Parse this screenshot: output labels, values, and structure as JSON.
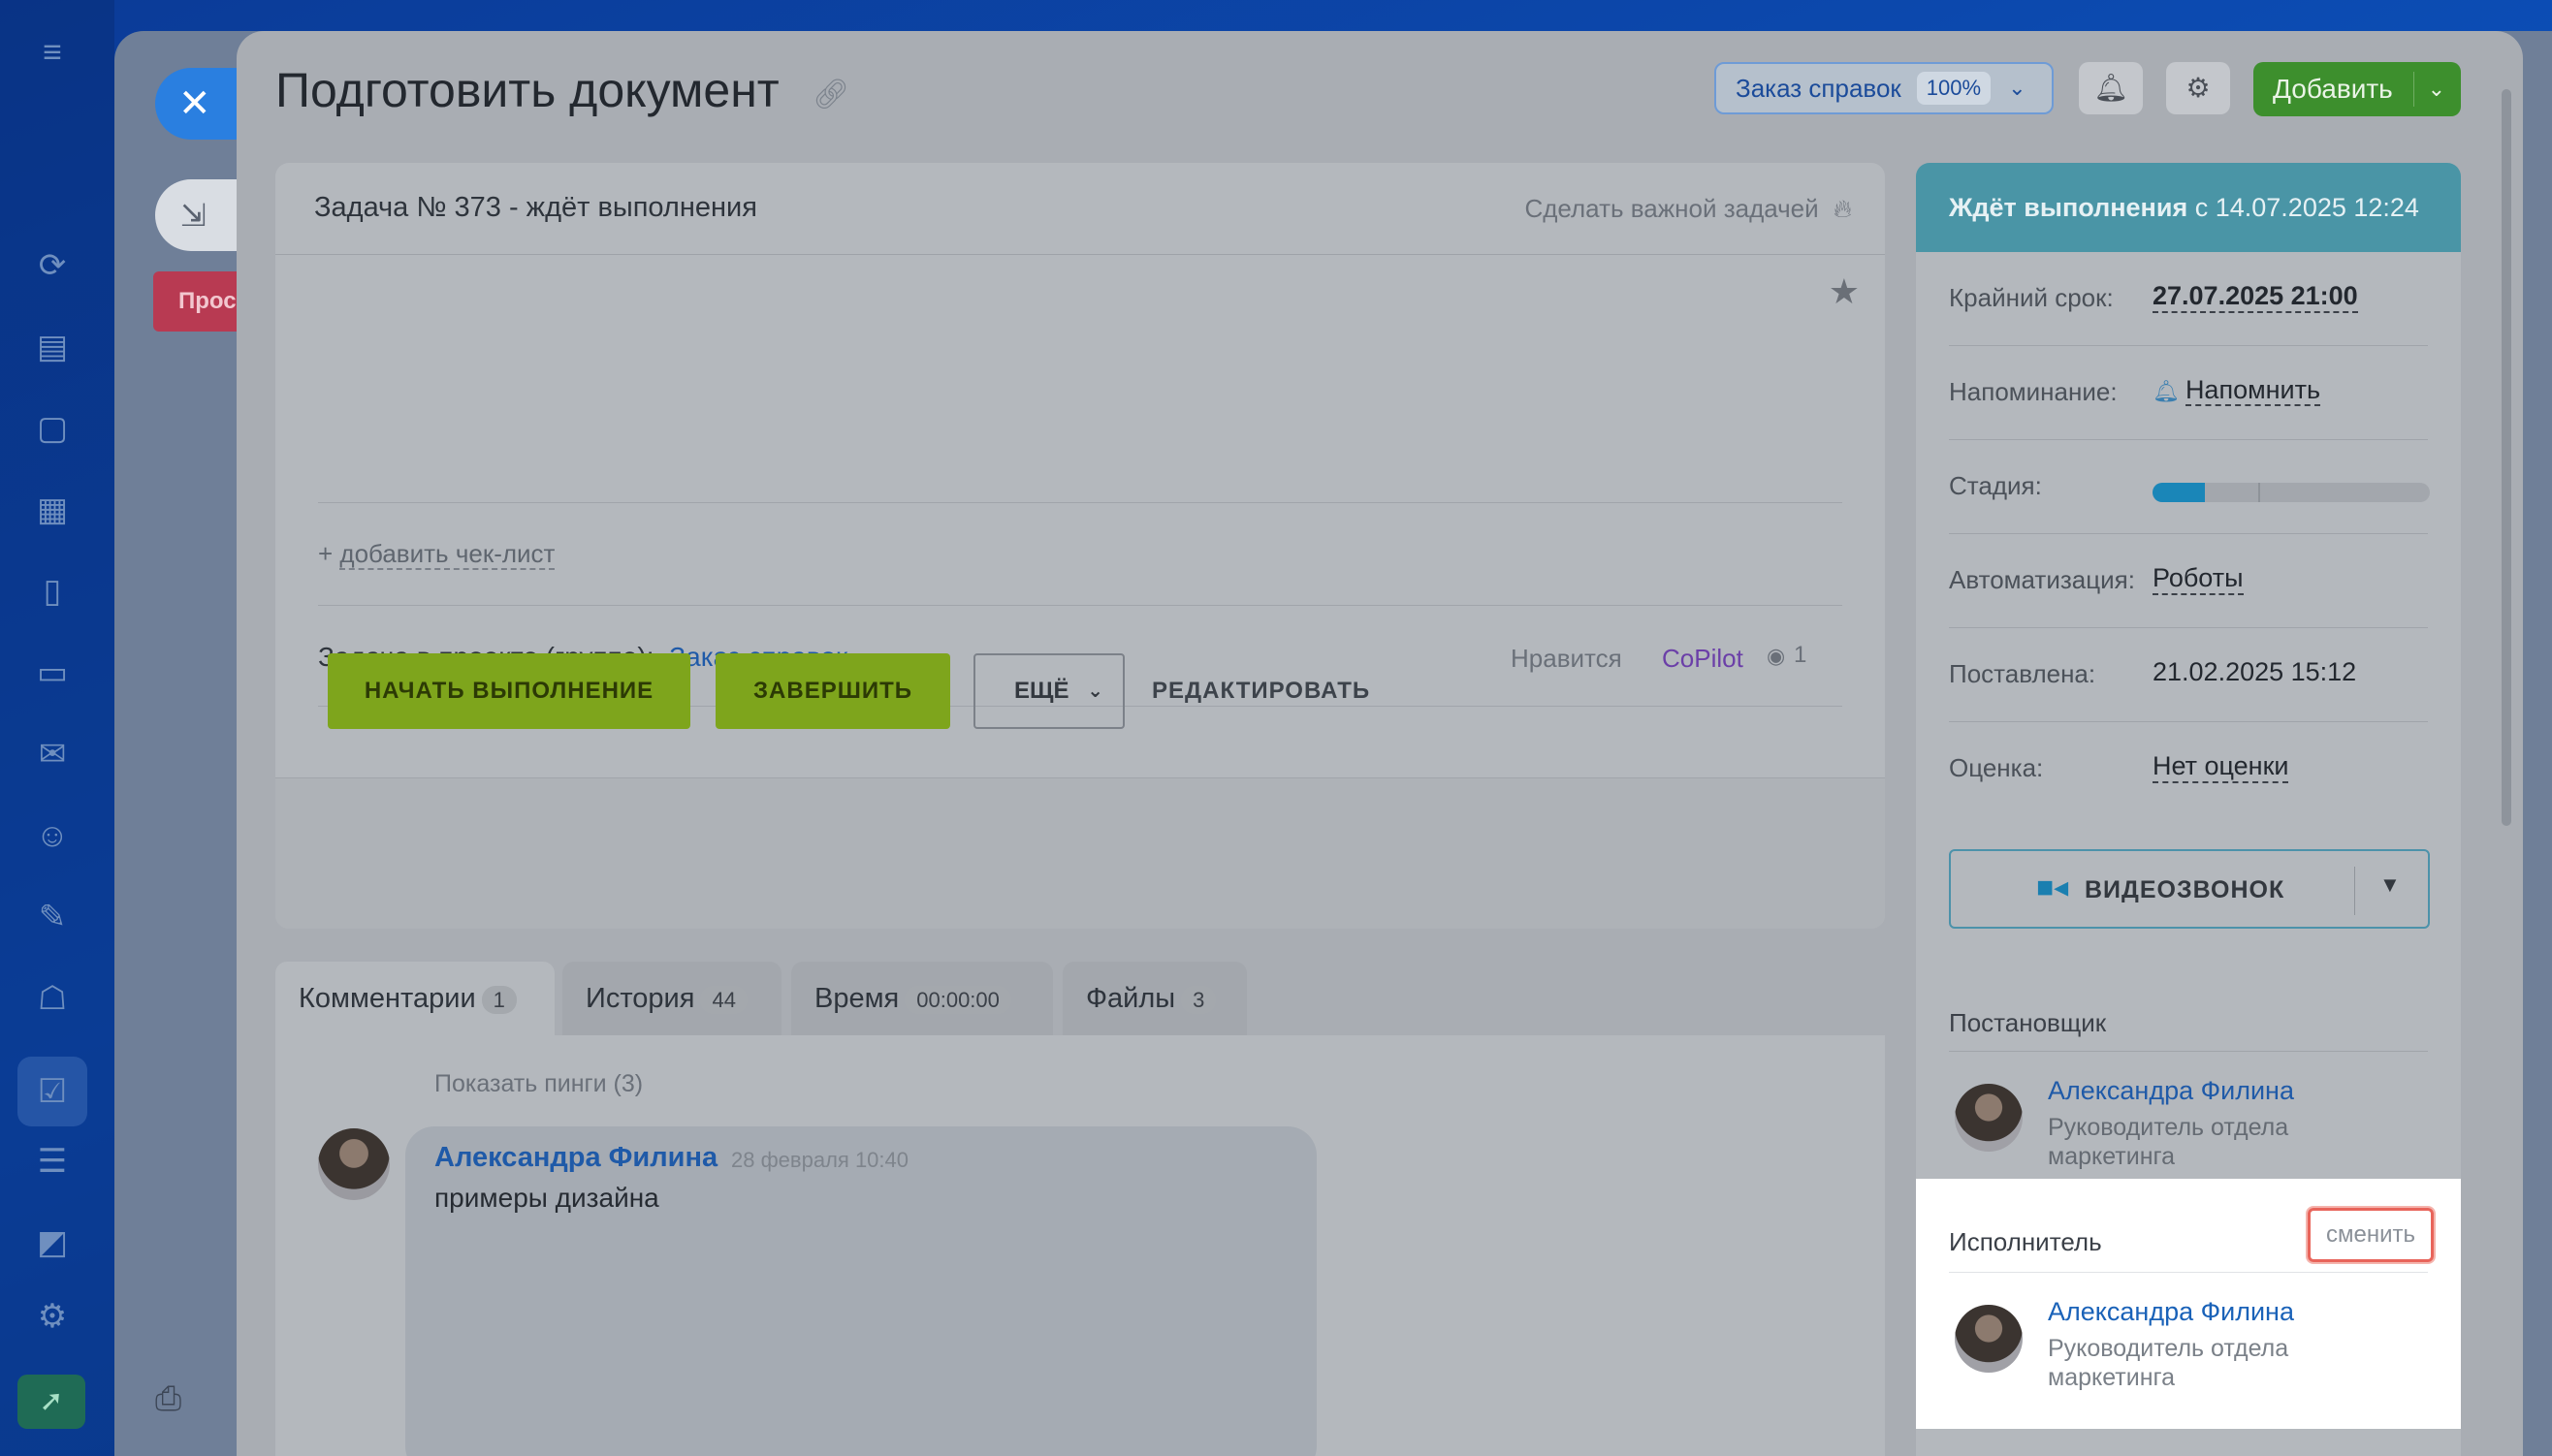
{
  "header": {
    "title": "Подготовить документ",
    "project_pill": {
      "label": "Заказ справок",
      "percent": "100%"
    },
    "add_label": "Добавить"
  },
  "background": {
    "red_label": "Прос"
  },
  "task": {
    "heading": "Задача № 373 - ждёт выполнения",
    "important_label": "Сделать важной задачей",
    "checklist_label": "добавить чек-лист",
    "project_prefix": "Задача в проекте (группе):",
    "project_name": "Заказ справок",
    "like_label": "Нравится",
    "like_author": "CoPilot",
    "views_count": "1"
  },
  "actions": {
    "start": "НАЧАТЬ ВЫПОЛНЕНИЕ",
    "finish": "ЗАВЕРШИТЬ",
    "more": "ЕЩЁ",
    "edit": "РЕДАКТИРОВАТЬ"
  },
  "tabs": [
    {
      "label": "Комментарии",
      "count": "1"
    },
    {
      "label": "История",
      "count": "44"
    },
    {
      "label": "Время",
      "count": "00:00:00"
    },
    {
      "label": "Файлы",
      "count": "3"
    }
  ],
  "comments": {
    "show_pings": "Показать пинги (3)",
    "items": [
      {
        "author": "Александра Филина",
        "date": "28 февраля 10:40",
        "text": "примеры дизайна"
      }
    ]
  },
  "sidebar": {
    "status_bold": "Ждёт выполнения",
    "status_rest": "с 14.07.2025 12:24",
    "properties": {
      "deadline_label": "Крайний срок:",
      "deadline_value": "27.07.2025 21:00",
      "reminder_label": "Напоминание:",
      "reminder_value": "Напомнить",
      "stage_label": "Стадия:",
      "stage_progress": 0.19,
      "stage_tick": 0.38,
      "automation_label": "Автоматизация:",
      "automation_value": "Роботы",
      "created_label": "Поставлена:",
      "created_value": "21.02.2025 15:12",
      "rating_label": "Оценка:",
      "rating_value": "Нет оценки"
    },
    "video_call_label": "ВИДЕОЗВОНОК",
    "creator": {
      "title": "Постановщик",
      "name": "Александра Филина",
      "role": "Руководитель отдела маркетинга"
    },
    "assignee": {
      "title": "Исполнитель",
      "change_label": "сменить",
      "name": "Александра Филина",
      "role": "Руководитель отдела маркетинга"
    }
  },
  "colors": {
    "accent_green": "#7ea51c",
    "status_teal": "#4a95a6",
    "link_blue": "#1f5aa8",
    "highlight_red": "#e8645a"
  }
}
